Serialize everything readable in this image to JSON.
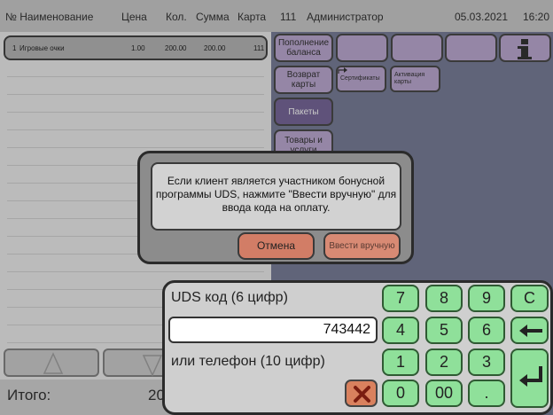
{
  "receipt": {
    "headers": {
      "num_name": "№ Наименование",
      "price": "Цена",
      "qty": "Кол.",
      "sum": "Сумма",
      "card": "Карта"
    },
    "rows": [
      {
        "num": "1",
        "name": "Игровые очки",
        "price": "1.00",
        "qty": "200.00",
        "sum": "200.00",
        "card": "111"
      }
    ],
    "total_label": "Итого:",
    "total_value": "20"
  },
  "topbar": {
    "card": "111",
    "user": "Администратор",
    "date": "05.03.2021",
    "time": "16:20"
  },
  "sidebar": [
    {
      "label": "Пополнение баланса"
    },
    {
      "label": "Возврат карты"
    },
    {
      "label": "Пакеты"
    },
    {
      "label": "Товары и услуги"
    }
  ],
  "tiles": [
    {
      "label": "Сертификаты"
    },
    {
      "label": "Активация карты"
    }
  ],
  "dialog": {
    "message": "Если клиент является участником бонусной программы UDS, нажмите \"Ввести вручную\" для ввода кода на оплату.",
    "cancel": "Отмена",
    "manual": "Ввести вручную"
  },
  "keypad": {
    "code_label": "UDS код (6 цифр)",
    "code_value": "743442",
    "phone_label": "или телефон (10 цифр)",
    "keys": {
      "k7": "7",
      "k8": "8",
      "k9": "9",
      "kc": "C",
      "k4": "4",
      "k5": "5",
      "k6": "6",
      "k1": "1",
      "k2": "2",
      "k3": "3",
      "k0": "0",
      "k00": "00",
      "kdot": "."
    }
  }
}
